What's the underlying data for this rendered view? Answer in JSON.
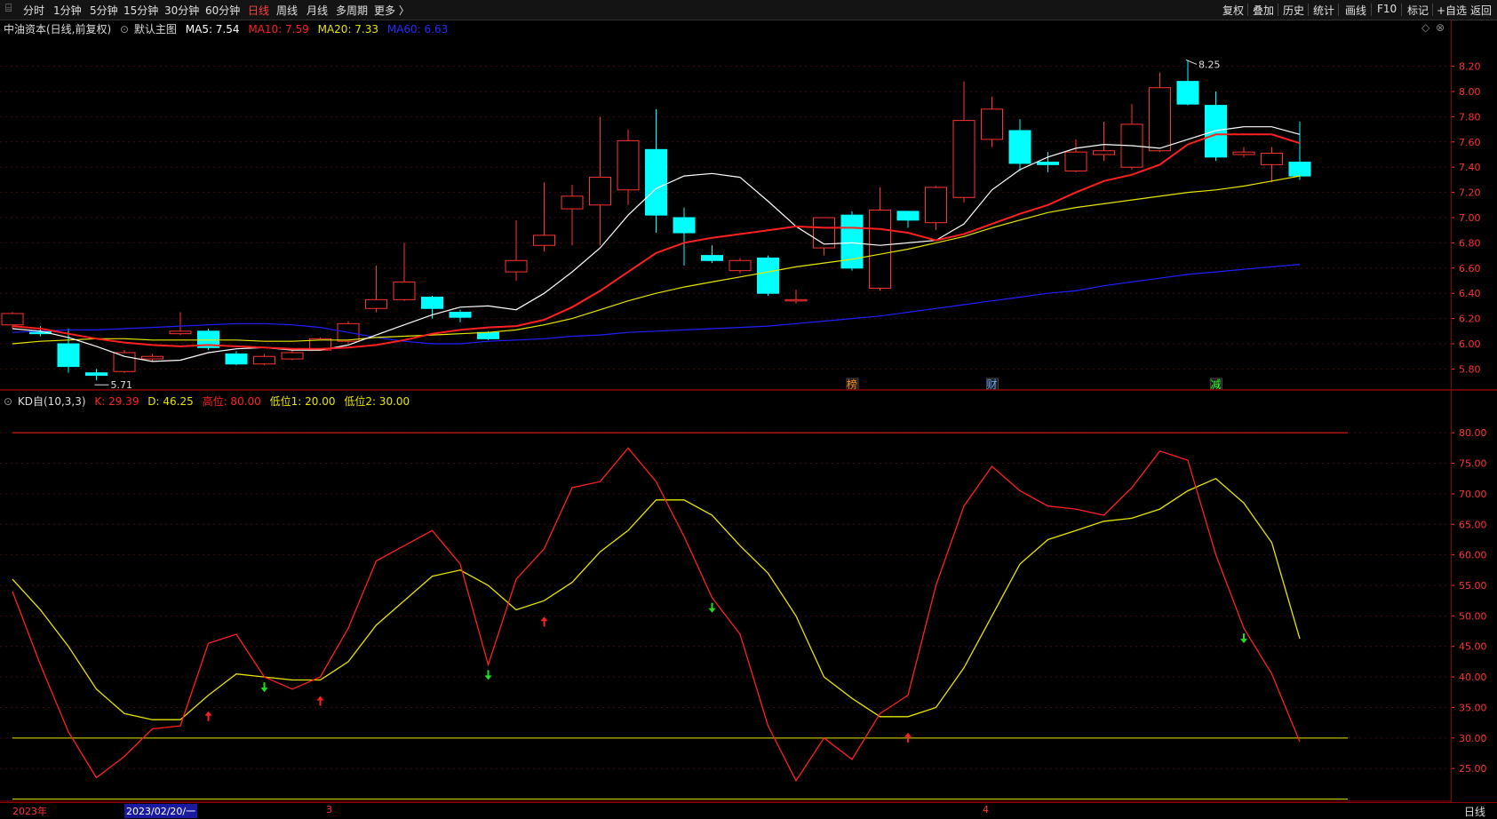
{
  "toolbar": {
    "tabs": [
      "分时",
      "1分钟",
      "5分钟",
      "15分钟",
      "30分钟",
      "60分钟",
      "日线",
      "周线",
      "月线",
      "多周期",
      "更多 〉"
    ],
    "active_tab": "日线",
    "right_buttons": [
      "复权",
      "叠加",
      "历史",
      "统计",
      "画线",
      "F10",
      "标记",
      "+自选",
      "返回"
    ]
  },
  "main_header": {
    "title": "中油资本(日线,前复权)",
    "template": "默认主图",
    "ma5": "MA5: 7.54",
    "ma10": "MA10: 7.59",
    "ma20": "MA20: 7.33",
    "ma60": "MA60: 6.63"
  },
  "kd_header": {
    "name": "KD自(10,3,3)",
    "k": "K: 29.39",
    "d": "D: 46.25",
    "high": "高位: 80.00",
    "low1": "低位1: 20.00",
    "low2": "低位2: 30.00"
  },
  "markers": {
    "high_label": "8.25",
    "low_label": "5.71",
    "event1": "榜",
    "event2": "财",
    "event3": "减"
  },
  "bottom": {
    "year": "2023年",
    "cursor_date": "2023/02/20/一",
    "month3": "3",
    "month4": "4",
    "period": "日线"
  },
  "colors": {
    "up": "#ff3333",
    "down": "#00ffff",
    "ma5": "#ffffff",
    "ma10": "#ff2020",
    "ma20": "#e6e600",
    "ma60": "#2020ff",
    "k_line": "#ff2020",
    "d_line": "#e6e600",
    "axis": "#ff3333"
  },
  "chart_data": {
    "type": "candlestick",
    "main_axis": {
      "min": 5.8,
      "max": 8.2,
      "step": 0.2,
      "ylim": [
        5.62,
        8.38
      ]
    },
    "kd_axis": {
      "min": 25,
      "max": 80,
      "step": 5,
      "ylim": [
        19.5,
        82.5
      ]
    },
    "candles": [
      [
        6.15,
        6.25,
        6.12,
        6.24
      ],
      [
        6.1,
        6.14,
        6.06,
        6.08
      ],
      [
        6.0,
        6.12,
        5.77,
        5.82
      ],
      [
        5.77,
        5.8,
        5.71,
        5.75
      ],
      [
        5.78,
        5.95,
        5.77,
        5.93
      ],
      [
        5.88,
        5.92,
        5.86,
        5.9
      ],
      [
        6.08,
        6.25,
        6.07,
        6.1
      ],
      [
        6.1,
        6.12,
        5.95,
        5.97
      ],
      [
        5.92,
        5.94,
        5.83,
        5.84
      ],
      [
        5.84,
        5.92,
        5.83,
        5.9
      ],
      [
        5.88,
        5.95,
        5.87,
        5.93
      ],
      [
        5.95,
        6.05,
        5.95,
        6.04
      ],
      [
        6.02,
        6.18,
        6.0,
        6.16
      ],
      [
        6.28,
        6.62,
        6.25,
        6.35
      ],
      [
        6.35,
        6.8,
        6.34,
        6.49
      ],
      [
        6.37,
        6.38,
        6.2,
        6.28
      ],
      [
        6.25,
        6.27,
        6.17,
        6.21
      ],
      [
        6.09,
        6.1,
        6.03,
        6.04
      ],
      [
        6.57,
        6.98,
        6.5,
        6.66
      ],
      [
        6.78,
        7.28,
        6.73,
        6.86
      ],
      [
        7.07,
        7.26,
        6.78,
        7.17
      ],
      [
        7.1,
        7.8,
        6.78,
        7.32
      ],
      [
        7.22,
        7.7,
        7.1,
        7.61
      ],
      [
        7.54,
        7.86,
        6.88,
        7.02
      ],
      [
        7.0,
        7.08,
        6.62,
        6.88
      ],
      [
        6.7,
        6.78,
        6.64,
        6.66
      ],
      [
        6.58,
        6.68,
        6.56,
        6.66
      ],
      [
        6.68,
        6.7,
        6.38,
        6.4
      ],
      [
        6.35,
        6.43,
        6.32,
        6.35
      ],
      [
        6.76,
        7.0,
        6.7,
        7.0
      ],
      [
        7.02,
        7.05,
        6.58,
        6.6
      ],
      [
        6.44,
        7.24,
        6.42,
        7.06
      ],
      [
        7.05,
        7.05,
        6.92,
        6.98
      ],
      [
        6.96,
        7.25,
        6.9,
        7.24
      ],
      [
        7.16,
        8.08,
        7.12,
        7.77
      ],
      [
        7.62,
        7.96,
        7.56,
        7.86
      ],
      [
        7.69,
        7.78,
        7.37,
        7.43
      ],
      [
        7.44,
        7.52,
        7.36,
        7.42
      ],
      [
        7.37,
        7.62,
        7.36,
        7.52
      ],
      [
        7.5,
        7.76,
        7.45,
        7.53
      ],
      [
        7.4,
        7.9,
        7.38,
        7.74
      ],
      [
        7.53,
        8.15,
        7.52,
        8.03
      ],
      [
        8.08,
        8.25,
        7.89,
        7.9
      ],
      [
        7.89,
        8.0,
        7.45,
        7.48
      ],
      [
        7.5,
        7.56,
        7.48,
        7.52
      ],
      [
        7.42,
        7.56,
        7.28,
        7.51
      ],
      [
        7.44,
        7.76,
        7.3,
        7.33
      ]
    ],
    "ma5": [
      6.12,
      6.1,
      6.05,
      5.98,
      5.9,
      5.86,
      5.87,
      5.93,
      5.96,
      5.97,
      5.95,
      5.95,
      5.99,
      6.07,
      6.15,
      6.23,
      6.29,
      6.3,
      6.27,
      6.4,
      6.57,
      6.76,
      7.02,
      7.23,
      7.33,
      7.35,
      7.32,
      7.13,
      6.93,
      6.79,
      6.8,
      6.78,
      6.8,
      6.82,
      6.95,
      7.22,
      7.38,
      7.48,
      7.55,
      7.58,
      7.57,
      7.55,
      7.62,
      7.69,
      7.72,
      7.72,
      7.66
    ],
    "ma10": [
      6.14,
      6.12,
      6.08,
      6.04,
      6.01,
      5.99,
      5.98,
      5.99,
      5.98,
      5.97,
      5.96,
      5.96,
      5.97,
      5.99,
      6.03,
      6.08,
      6.11,
      6.13,
      6.14,
      6.19,
      6.29,
      6.42,
      6.57,
      6.72,
      6.8,
      6.84,
      6.87,
      6.9,
      6.93,
      6.92,
      6.92,
      6.91,
      6.88,
      6.82,
      6.87,
      6.95,
      7.03,
      7.1,
      7.2,
      7.29,
      7.34,
      7.42,
      7.58,
      7.66,
      7.66,
      7.66,
      7.59
    ],
    "ma20": [
      6.0,
      6.02,
      6.03,
      6.04,
      6.04,
      6.03,
      6.03,
      6.03,
      6.03,
      6.02,
      6.02,
      6.03,
      6.03,
      6.05,
      6.06,
      6.07,
      6.08,
      6.09,
      6.11,
      6.15,
      6.2,
      6.27,
      6.34,
      6.4,
      6.45,
      6.49,
      6.53,
      6.57,
      6.61,
      6.64,
      6.67,
      6.71,
      6.75,
      6.8,
      6.85,
      6.92,
      6.98,
      7.04,
      7.08,
      7.11,
      7.14,
      7.17,
      7.2,
      7.22,
      7.25,
      7.29,
      7.33
    ],
    "ma60": [
      6.09,
      6.1,
      6.11,
      6.11,
      6.12,
      6.13,
      6.14,
      6.15,
      6.16,
      6.16,
      6.15,
      6.13,
      6.09,
      6.05,
      6.02,
      6.0,
      6.0,
      6.02,
      6.03,
      6.04,
      6.06,
      6.07,
      6.09,
      6.1,
      6.11,
      6.12,
      6.13,
      6.14,
      6.16,
      6.18,
      6.2,
      6.22,
      6.25,
      6.28,
      6.31,
      6.34,
      6.37,
      6.4,
      6.42,
      6.46,
      6.49,
      6.52,
      6.55,
      6.57,
      6.59,
      6.61,
      6.63
    ],
    "k": [
      54.0,
      42.0,
      31.0,
      23.5,
      27.0,
      31.5,
      32.0,
      45.5,
      47.0,
      40.0,
      38.0,
      40.0,
      48.0,
      59.0,
      61.5,
      64.0,
      58.5,
      42.0,
      56.0,
      61.0,
      71.0,
      72.0,
      77.5,
      72.0,
      63.0,
      53.0,
      47.0,
      32.0,
      23.0,
      30.0,
      26.5,
      34.0,
      37.0,
      55.0,
      68.0,
      74.5,
      70.5,
      68.0,
      67.5,
      66.5,
      71.0,
      77.0,
      75.5,
      60.0,
      48.0,
      40.5,
      29.39
    ],
    "d": [
      56.0,
      51.0,
      45.0,
      38.0,
      34.0,
      33.0,
      33.0,
      37.0,
      40.5,
      40.0,
      39.5,
      39.5,
      42.5,
      48.5,
      52.5,
      56.5,
      57.5,
      55.0,
      51.0,
      52.5,
      55.5,
      60.5,
      64.0,
      69.0,
      69.0,
      66.5,
      61.5,
      57.0,
      50.0,
      40.0,
      36.5,
      33.5,
      33.5,
      35.0,
      41.5,
      50.0,
      58.5,
      62.5,
      64.0,
      65.5,
      66.0,
      67.5,
      70.5,
      72.5,
      68.5,
      62.0,
      46.25
    ],
    "kd_levels": {
      "high": 80,
      "low2": 30,
      "low1": 20
    },
    "signals": [
      {
        "i": 7,
        "type": "up"
      },
      {
        "i": 9,
        "type": "down"
      },
      {
        "i": 11,
        "type": "up"
      },
      {
        "i": 17,
        "type": "down"
      },
      {
        "i": 19,
        "type": "up"
      },
      {
        "i": 25,
        "type": "down"
      },
      {
        "i": 32,
        "type": "up"
      },
      {
        "i": 44,
        "type": "down"
      }
    ],
    "events": [
      {
        "i": 30,
        "key": "event1",
        "color": "#ff8c1a"
      },
      {
        "i": 35,
        "key": "event2",
        "color": "#66aaff"
      },
      {
        "i": 43,
        "key": "event3",
        "color": "#33ff33"
      }
    ],
    "high_index": 42,
    "low_index": 3
  }
}
